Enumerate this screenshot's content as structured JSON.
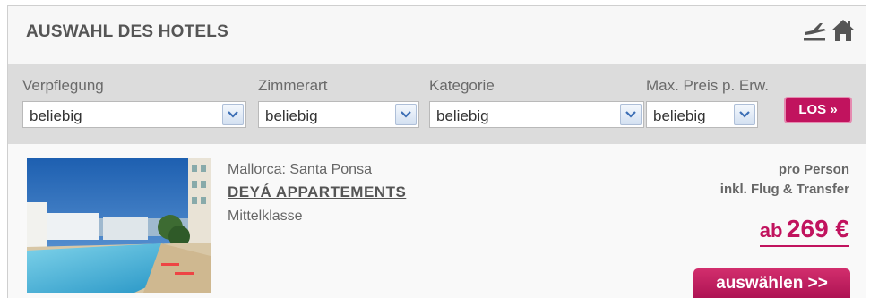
{
  "header": {
    "title": "AUSWAHL DES HOTELS",
    "icons": [
      "airplane-icon",
      "home-icon"
    ]
  },
  "filters": {
    "verpflegung": {
      "label": "Verpflegung",
      "value": "beliebig"
    },
    "zimmerart": {
      "label": "Zimmerart",
      "value": "beliebig"
    },
    "kategorie": {
      "label": "Kategorie",
      "value": "beliebig"
    },
    "max_preis": {
      "label": "Max. Preis p. Erw.",
      "value": "beliebig"
    },
    "submit_label": "LOS »"
  },
  "hotel": {
    "location": "Mallorca: Santa Ponsa",
    "name": "DEYÁ APPARTEMENTS",
    "category": "Mittelklasse",
    "price_note_1": "pro Person",
    "price_note_2": "inkl. Flug & Transfer",
    "price_prefix": "ab",
    "price": "269 €",
    "select_label": "auswählen >>"
  },
  "colors": {
    "accent": "#c1135e",
    "filter_bar": "#dcdcdc",
    "background": "#f7f7f7"
  }
}
